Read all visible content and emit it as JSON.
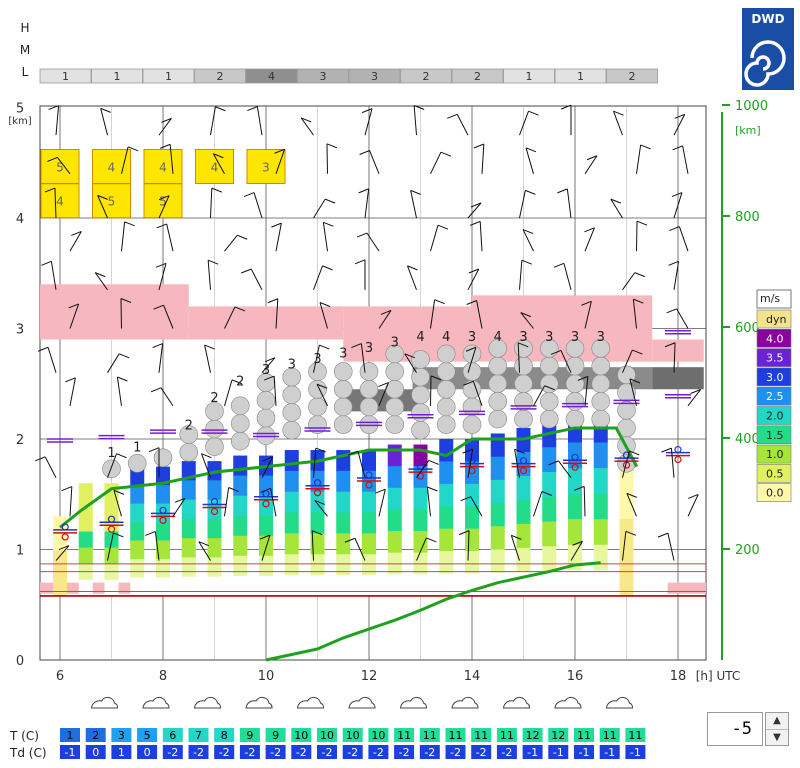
{
  "logo": {
    "text": "DWD"
  },
  "cloud_rows": {
    "labels": [
      "H",
      "M",
      "L"
    ],
    "low_values": [
      "1",
      "1",
      "1",
      "2",
      "4",
      "3",
      "3",
      "2",
      "2",
      "1",
      "1",
      "2"
    ]
  },
  "axes": {
    "left_unit": "[km]",
    "left_ticks": [
      "0",
      "1",
      "2",
      "3",
      "4",
      "5"
    ],
    "right_unit": "[km]",
    "right_ticks": [
      "200",
      "400",
      "600",
      "800",
      "1000"
    ],
    "x_ticks": [
      "6",
      "8",
      "10",
      "12",
      "14",
      "16",
      "18"
    ],
    "x_unit": "[h] UTC"
  },
  "legend": {
    "title": "m/s",
    "items": [
      {
        "label": "dyn",
        "color": "#f5e38c"
      },
      {
        "label": "4.0",
        "color": "#8a009e"
      },
      {
        "label": "3.5",
        "color": "#6a22d6"
      },
      {
        "label": "3.0",
        "color": "#1d3fe0"
      },
      {
        "label": "2.5",
        "color": "#1f8ff0"
      },
      {
        "label": "2.0",
        "color": "#22d6c8"
      },
      {
        "label": "1.5",
        "color": "#22dc8a"
      },
      {
        "label": "1.0",
        "color": "#a6e63a"
      },
      {
        "label": "0.5",
        "color": "#e0f060"
      },
      {
        "label": "0.0",
        "color": "#fff8a8"
      }
    ]
  },
  "chart_data": {
    "type": "bar",
    "x": [
      6.0,
      6.5,
      7.0,
      7.5,
      8.0,
      8.5,
      9.0,
      9.5,
      10.0,
      10.5,
      11.0,
      11.5,
      12.0,
      12.5,
      13.0,
      13.5,
      14.0,
      14.5,
      15.0,
      15.5,
      16.0,
      16.5,
      17.0
    ],
    "thermal_top_km": [
      1.3,
      1.6,
      1.6,
      1.75,
      1.75,
      1.8,
      1.8,
      1.85,
      1.85,
      1.9,
      1.9,
      1.9,
      1.9,
      1.95,
      1.95,
      2.0,
      2.0,
      2.05,
      2.1,
      2.15,
      2.2,
      2.2,
      1.8
    ],
    "thermal_base_km": 0.58,
    "mixing_layer_km": [
      null,
      null,
      null,
      null,
      null,
      null,
      null,
      null,
      0.0,
      0.05,
      0.1,
      0.2,
      0.28,
      0.36,
      0.45,
      0.55,
      0.63,
      0.7,
      0.75,
      0.8,
      0.86,
      0.88,
      null
    ],
    "cloud_base_km": [
      1.55,
      1.6,
      1.65,
      1.7,
      1.75,
      1.8,
      1.85,
      1.9,
      1.95,
      2.0,
      2.05,
      2.05,
      2.05,
      2.05,
      2.0,
      2.05,
      2.05,
      2.1,
      2.1,
      2.1,
      2.1,
      2.1,
      1.7
    ],
    "cloud_top_km": [
      null,
      null,
      1.8,
      1.85,
      1.95,
      2.05,
      2.3,
      2.45,
      2.55,
      2.6,
      2.65,
      2.7,
      2.75,
      2.8,
      2.85,
      2.85,
      2.85,
      2.85,
      2.85,
      2.85,
      2.85,
      2.85,
      2.6
    ],
    "cumulus_numbers": [
      "",
      "",
      "1",
      "1",
      "",
      "2",
      "2",
      "2",
      "3",
      "3",
      "3",
      "3",
      "3",
      "3",
      "4",
      "4",
      "3",
      "4",
      "3",
      "3",
      "3",
      "3",
      ""
    ],
    "fl_1000m_line": [
      [
        6.0,
        1.2
      ],
      [
        6.4,
        1.35
      ],
      [
        7.0,
        1.55
      ],
      [
        8.0,
        1.6
      ],
      [
        8.5,
        1.65
      ],
      [
        9.0,
        1.7
      ],
      [
        10.0,
        1.75
      ],
      [
        11.0,
        1.8
      ],
      [
        12.0,
        1.9
      ],
      [
        13.0,
        1.9
      ],
      [
        13.5,
        1.85
      ],
      [
        14.0,
        2.0
      ],
      [
        15.0,
        2.0
      ],
      [
        16.0,
        2.1
      ],
      [
        16.8,
        2.1
      ],
      [
        17.2,
        1.75
      ]
    ],
    "ltq_layers_km": [
      [
        2.9,
        3.4,
        6.0,
        8.5
      ],
      [
        2.9,
        3.2,
        8.5,
        11.5
      ],
      [
        2.7,
        3.2,
        11.5,
        14.0
      ],
      [
        2.7,
        3.3,
        14.0,
        17.5
      ],
      [
        2.7,
        2.9,
        17.5,
        18.5
      ]
    ],
    "inversion_levels_km": [
      0.58,
      0.62,
      0.8,
      0.87
    ],
    "dewpoint_markers": [
      [
        6.1,
        1.15
      ],
      [
        7.0,
        1.22
      ],
      [
        8.0,
        1.3
      ],
      [
        9.0,
        1.38
      ],
      [
        10.0,
        1.45
      ],
      [
        11.0,
        1.55
      ],
      [
        12.0,
        1.62
      ],
      [
        13.0,
        1.7
      ],
      [
        14.0,
        1.75
      ],
      [
        15.0,
        1.75
      ],
      [
        16.0,
        1.78
      ],
      [
        17.0,
        1.8
      ],
      [
        18.0,
        1.85
      ]
    ],
    "upper_markers": [
      [
        6.0,
        2.0
      ],
      [
        7.0,
        2.03
      ],
      [
        8.0,
        2.08
      ],
      [
        9.0,
        2.08
      ],
      [
        10.0,
        2.05
      ],
      [
        11.0,
        2.1
      ],
      [
        12.0,
        2.15
      ],
      [
        13.0,
        2.22
      ],
      [
        14.0,
        2.25
      ],
      [
        15.0,
        2.3
      ],
      [
        16.0,
        2.32
      ],
      [
        17.0,
        2.35
      ],
      [
        18.0,
        2.4
      ],
      [
        18.0,
        2.98
      ]
    ],
    "alto_clouds": [
      {
        "hour": 6.0,
        "upper": "5",
        "lower": "4"
      },
      {
        "hour": 7.0,
        "upper": "4",
        "lower": "5"
      },
      {
        "hour": 8.0,
        "upper": "4",
        "lower": "5"
      },
      {
        "hour": 9.0,
        "upper": "4",
        "lower": ""
      },
      {
        "hour": 10.0,
        "upper": "3",
        "lower": ""
      }
    ],
    "ylim_km": [
      0,
      5
    ],
    "ylim_right": [
      0,
      1000
    ],
    "xlim_h": [
      5.5,
      19.0
    ]
  },
  "weather_symbols": [
    7,
    8,
    9,
    10,
    11,
    12,
    13,
    14,
    15,
    16,
    17
  ],
  "temps": {
    "t_label": "T  (C)",
    "td_label": "Td (C)",
    "t": [
      "1",
      "2",
      "3",
      "5",
      "6",
      "7",
      "8",
      "9",
      "9",
      "10",
      "10",
      "10",
      "10",
      "11",
      "11",
      "11",
      "11",
      "11",
      "12",
      "12",
      "11",
      "11",
      "11"
    ],
    "td": [
      "-1",
      "0",
      "1",
      "0",
      "-2",
      "-2",
      "-2",
      "-2",
      "-2",
      "-2",
      "-2",
      "-2",
      "-2",
      "-2",
      "-2",
      "-2",
      "-2",
      "-2",
      "-1",
      "-1",
      "-1",
      "-1",
      "-1"
    ]
  },
  "spinner": {
    "value": "-5",
    "up": "▲",
    "down": "▼"
  }
}
